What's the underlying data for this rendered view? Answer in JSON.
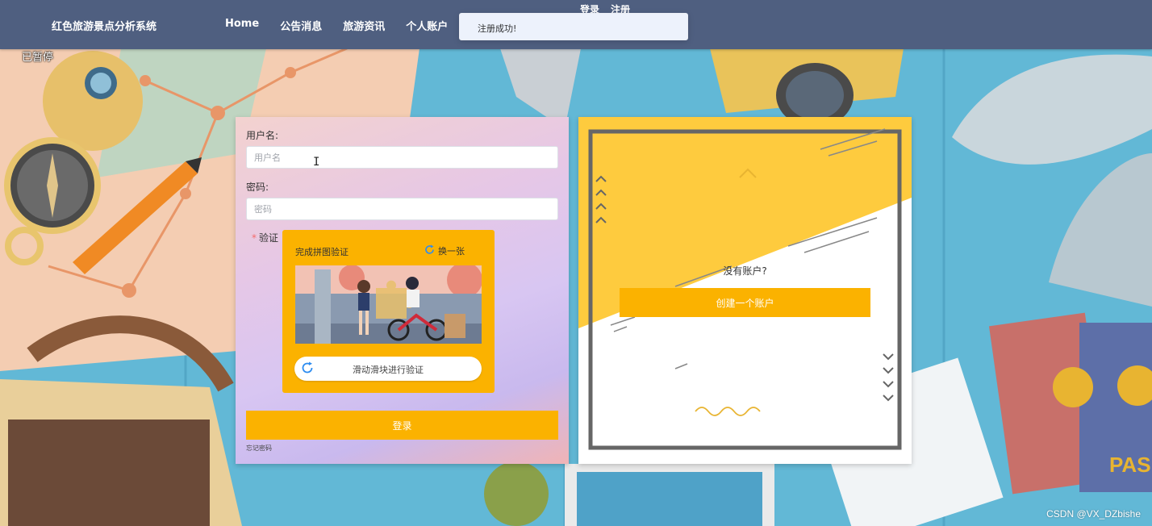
{
  "app": {
    "brand": "红色旅游景点分析系统",
    "nav": [
      "Home",
      "公告消息",
      "旅游资讯",
      "个人账户"
    ],
    "auth_links": {
      "login": "登录",
      "register": "注册"
    },
    "toast": "注册成功!",
    "paused_label": "已暂停"
  },
  "login_form": {
    "username_label": "用户名:",
    "username_placeholder": "用户名",
    "password_label": "密码:",
    "password_placeholder": "密码",
    "captcha_label": "验证",
    "captcha_required_mark": "*",
    "captcha": {
      "title": "完成拼图验证",
      "refresh_label": "换一张",
      "slider_hint": "滑动滑块进行验证"
    },
    "submit_label": "登录",
    "forgot_label": "忘记密码"
  },
  "register_panel": {
    "prompt": "没有账户?",
    "create_label": "创建一个账户"
  },
  "watermark": "CSDN @VX_DZbishe",
  "colors": {
    "topbar": "#4f5f80",
    "accent": "#fbb200",
    "toast_bg": "#edf2fc"
  },
  "icons": {
    "refresh": "refresh-icon",
    "slider": "rotate-icon",
    "caret": "text-cursor-icon"
  }
}
